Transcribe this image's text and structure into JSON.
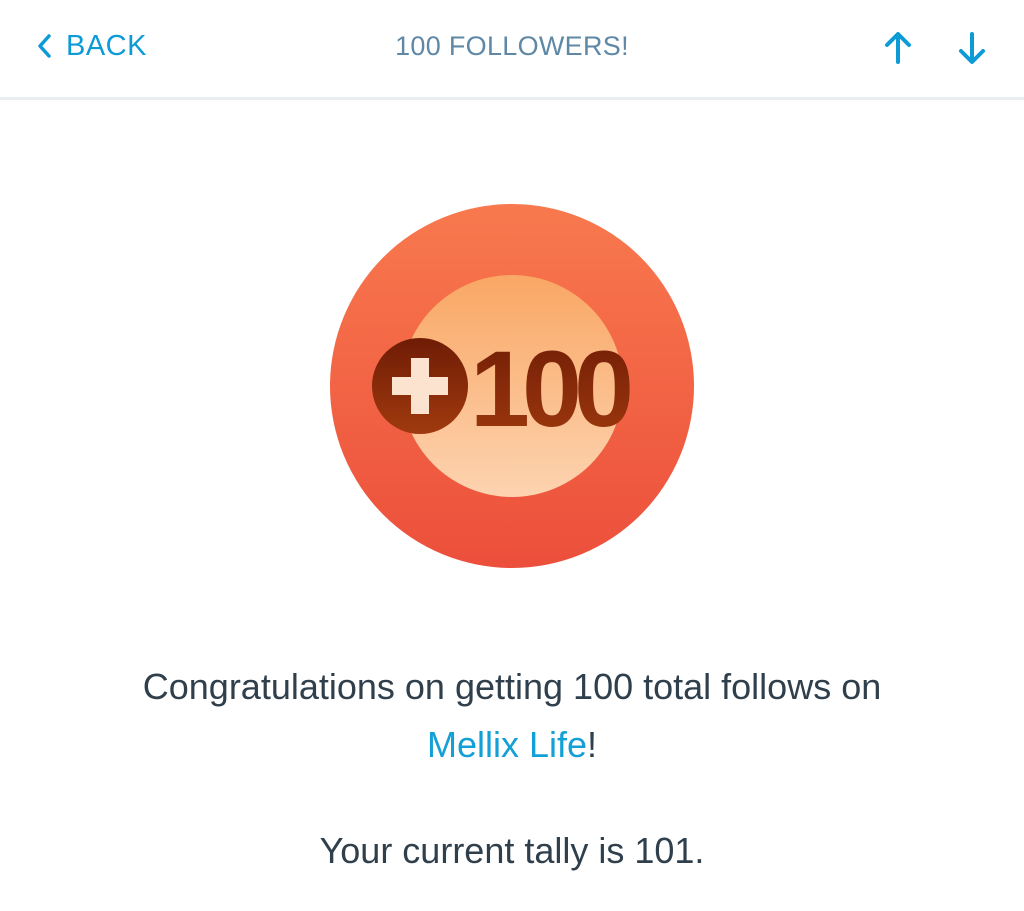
{
  "header": {
    "back_label": "BACK",
    "title": "100 FOLLOWERS!",
    "prev_icon": "arrow-up-icon",
    "next_icon": "arrow-down-icon"
  },
  "badge": {
    "icon": "plus-100-badge-icon",
    "text": "100"
  },
  "message": {
    "prefix": "Congratulations on getting 100 total follows on",
    "site_name": "Mellix Life",
    "suffix": "!",
    "tally": "Your current tally is 101."
  },
  "colors": {
    "accent": "#0d9bd8",
    "title": "#5f88a6",
    "text": "#2f3f4c",
    "badge_outer": "#f26b4a",
    "badge_inner": "#fbbf8a",
    "badge_mark": "#8a2a08"
  }
}
